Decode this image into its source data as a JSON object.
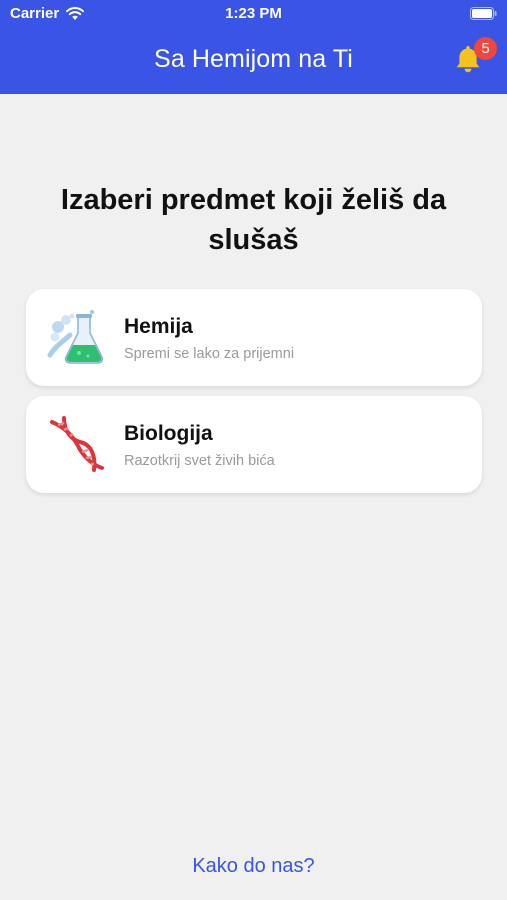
{
  "status_bar": {
    "carrier": "Carrier",
    "time": "1:23 PM"
  },
  "nav": {
    "title": "Sa Hemijom na Ti",
    "notification_count": "5"
  },
  "main": {
    "heading": "Izaberi predmet koji želiš da slušaš",
    "subjects": [
      {
        "title": "Hemija",
        "subtitle": "Spremi se lako za prijemni",
        "icon": "chemistry-flask-icon"
      },
      {
        "title": "Biologija",
        "subtitle": "Razotkrij svet živih bića",
        "icon": "dna-icon"
      }
    ]
  },
  "footer": {
    "link_label": "Kako do nas?"
  },
  "colors": {
    "primary": "#3a55e6",
    "background": "#f0f0f0",
    "badge": "#f0463c",
    "bell": "#f6c21c"
  }
}
